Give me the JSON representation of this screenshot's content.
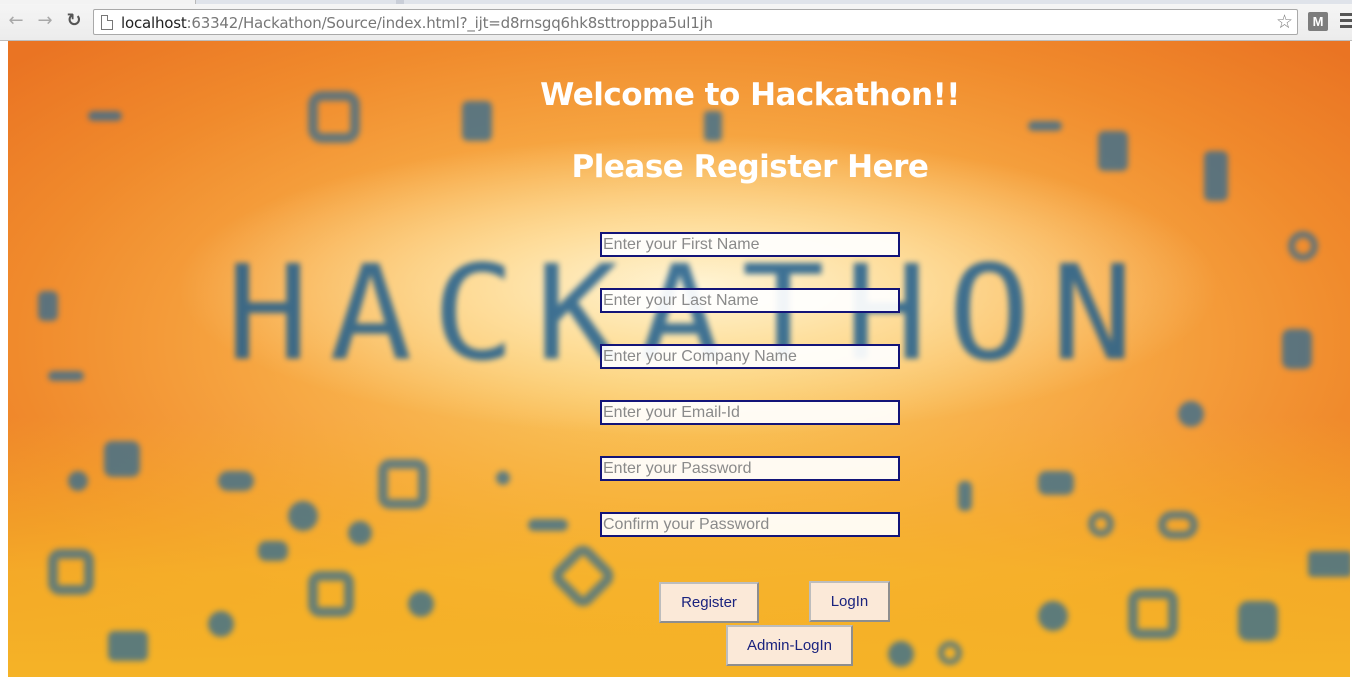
{
  "browser": {
    "url_host": "localhost",
    "url_rest": ":63342/Hackathon/Source/index.html?_ijt=d8rnsgq6hk8sttropppa5ul1jh",
    "extension_label": "M",
    "icons": [
      "back-arrow-icon",
      "forward-arrow-icon",
      "reload-icon",
      "page-icon",
      "bookmark-star-icon",
      "extension-icon",
      "menu-icon"
    ]
  },
  "background": {
    "word": "HACKATHON",
    "colors": {
      "orange": "#ef7e27",
      "yellow": "#f7b62c",
      "glow": "#fff5d7",
      "blue": "#1d5d8e"
    }
  },
  "page": {
    "title": "Welcome to Hackathon!!",
    "subtitle": "Please Register Here"
  },
  "form": {
    "first_name_placeholder": "Enter your First Name",
    "last_name_placeholder": "Enter your Last Name",
    "company_placeholder": "Enter your Company Name",
    "email_placeholder": "Enter your Email-Id",
    "password_placeholder": "Enter your Password",
    "confirm_password_placeholder": "Confirm your Password",
    "register_label": "Register",
    "login_label": "LogIn",
    "admin_login_label": "Admin-LogIn"
  },
  "colors": {
    "field_border": "#131478",
    "button_bg": "#fbe9d8",
    "button_text": "#1a237e",
    "heading_text": "#ffffff"
  }
}
